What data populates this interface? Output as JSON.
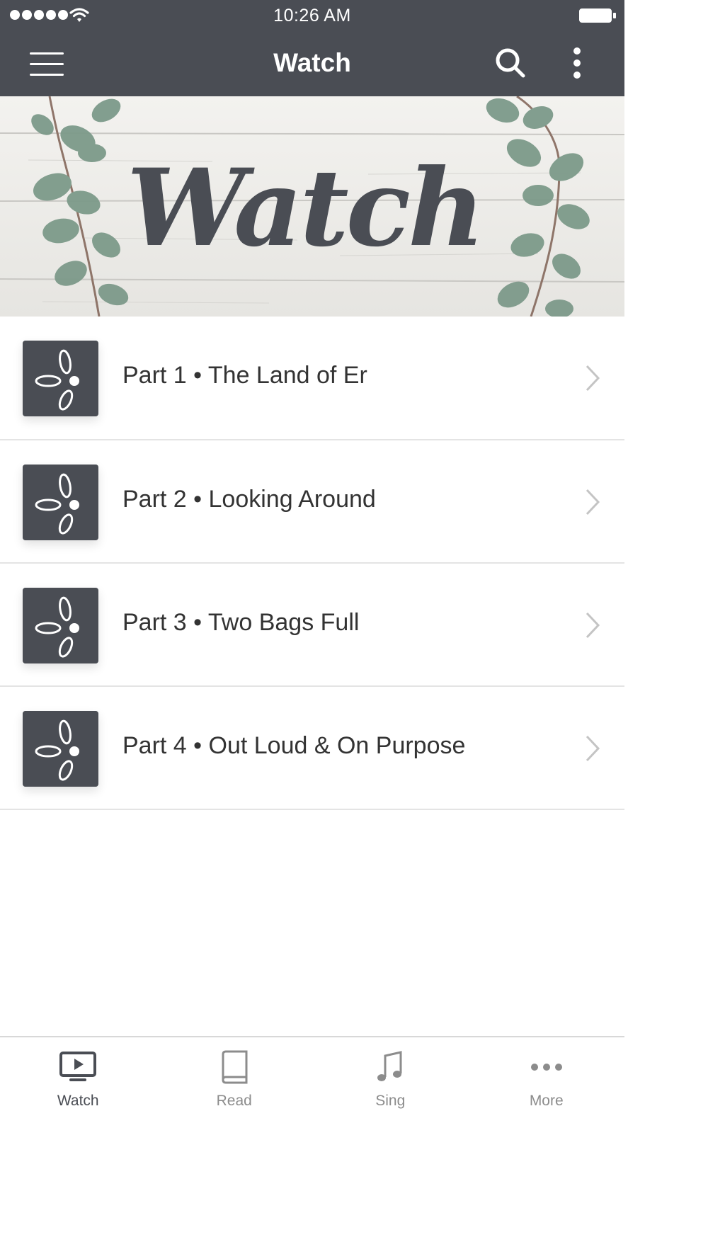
{
  "status_bar": {
    "time": "10:26 AM"
  },
  "navbar": {
    "title": "Watch",
    "background": "#4a4d54"
  },
  "banner": {
    "script_text": "Watch"
  },
  "list": {
    "items": [
      {
        "label": "Part 1 • The Land of Er"
      },
      {
        "label": "Part 2 • Looking Around"
      },
      {
        "label": "Part 3 • Two Bags Full"
      },
      {
        "label": "Part 4 • Out Loud & On Purpose"
      }
    ]
  },
  "tabbar": {
    "tabs": [
      {
        "label": "Watch",
        "icon": "tv-play-icon",
        "active": true
      },
      {
        "label": "Read",
        "icon": "book-icon",
        "active": false
      },
      {
        "label": "Sing",
        "icon": "music-note-icon",
        "active": false
      },
      {
        "label": "More",
        "icon": "more-dots-icon",
        "active": false
      }
    ]
  },
  "colors": {
    "accent": "#4a4d54",
    "text": "#333333",
    "inactive": "#8c8c8c",
    "separator": "#e4e4e4"
  }
}
